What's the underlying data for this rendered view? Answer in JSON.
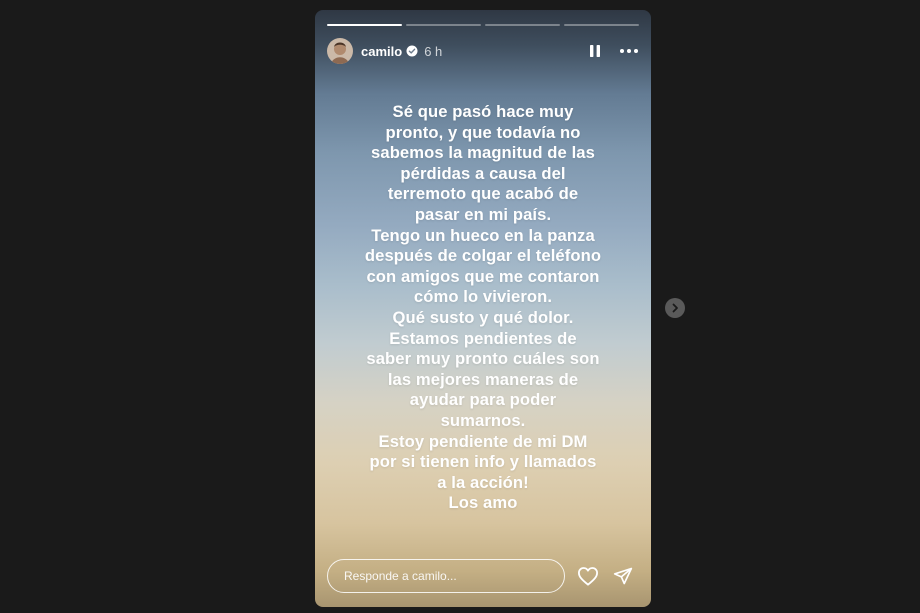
{
  "story": {
    "progress": [
      1,
      0,
      0,
      0
    ],
    "user": {
      "username": "camilo",
      "time": "6 h",
      "verified": true
    },
    "text_lines": [
      "Sé que pasó hace muy",
      "pronto, y que todavía no",
      "sabemos la magnitud de las",
      "pérdidas a causa del",
      "terremoto que acabó de",
      "pasar en mi país.",
      "Tengo un hueco en la panza",
      "después de colgar el teléfono",
      "con amigos que me contaron",
      "cómo lo vivieron.",
      "Qué susto y qué dolor.",
      "Estamos pendientes de",
      "saber muy pronto cuáles son",
      "las mejores maneras de",
      "ayudar para poder",
      "sumarnos.",
      "Estoy pendiente de mi DM",
      "por si tienen info y llamados",
      "a la acción!",
      "Los amo"
    ],
    "reply_placeholder": "Responde a camilo..."
  },
  "icons": {
    "verified": "verified-badge-icon",
    "pause": "pause-icon",
    "more": "more-options-icon",
    "like": "heart-icon",
    "share": "send-icon",
    "next": "chevron-right-icon"
  },
  "colors": {
    "page_bg": "#1a1a1a",
    "text": "#ffffff",
    "next_button_bg": "#5a5a5a"
  }
}
